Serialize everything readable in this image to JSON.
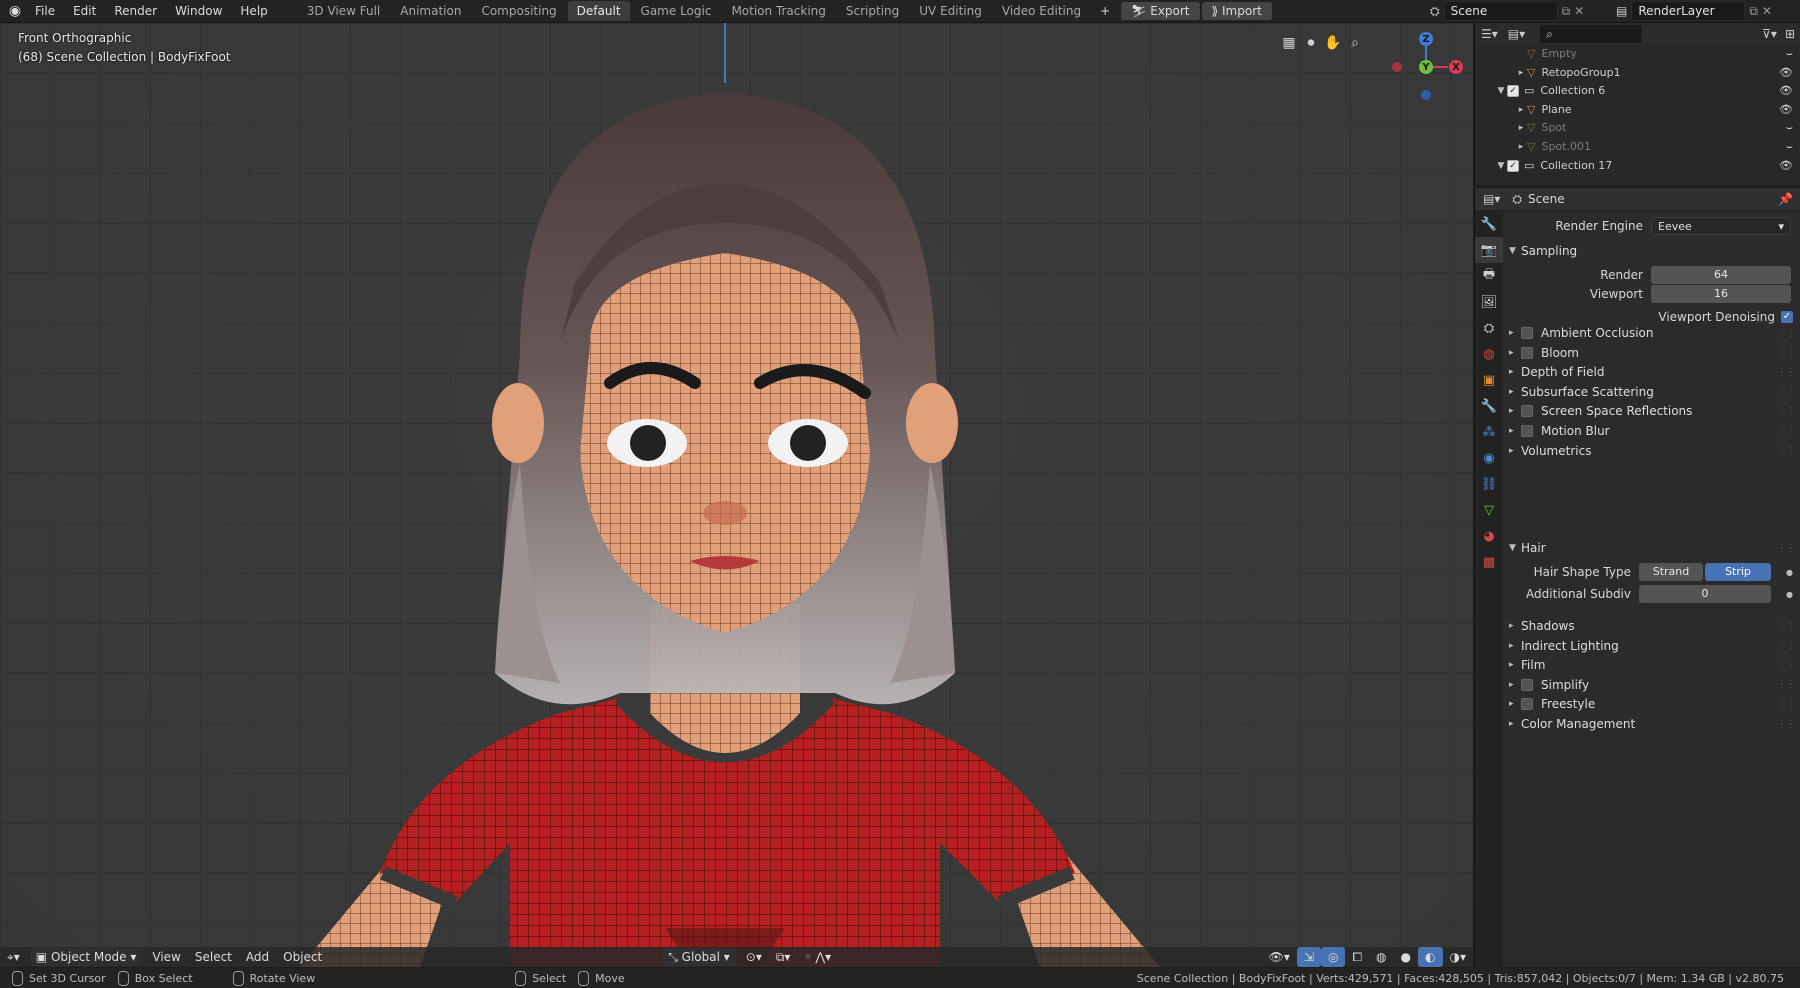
{
  "topbar": {
    "menus": [
      "File",
      "Edit",
      "Render",
      "Window",
      "Help"
    ],
    "workspaces": [
      "3D View Full",
      "Animation",
      "Compositing",
      "Default",
      "Game Logic",
      "Motion Tracking",
      "Scripting",
      "UV Editing",
      "Video Editing"
    ],
    "active_workspace": "Default",
    "export_label": "Export",
    "import_label": "Import",
    "scene_name": "Scene",
    "view_layer": "RenderLayer"
  },
  "viewport": {
    "view_name": "Front Orthographic",
    "collection_info": "(68) Scene Collection | BodyFixFoot",
    "gizmo": {
      "z": "Z",
      "y": "Y",
      "x": "X"
    }
  },
  "viewport_header": {
    "mode": "Object Mode",
    "menus": [
      "View",
      "Select",
      "Add",
      "Object"
    ],
    "orientation": "Global"
  },
  "outliner": {
    "search_placeholder": "",
    "rows": [
      {
        "name": "Empty",
        "dim": true,
        "indent": 2,
        "checkbox": false,
        "expand": false
      },
      {
        "name": "RetopoGroup1",
        "dim": false,
        "indent": 2,
        "checkbox": false,
        "expand": true
      },
      {
        "name": "Collection 6",
        "dim": false,
        "indent": 1,
        "checkbox": true,
        "expand": true
      },
      {
        "name": "Plane",
        "dim": false,
        "indent": 2,
        "checkbox": false,
        "expand": true
      },
      {
        "name": "Spot",
        "dim": true,
        "indent": 2,
        "checkbox": false,
        "expand": true
      },
      {
        "name": "Spot.001",
        "dim": true,
        "indent": 2,
        "checkbox": false,
        "expand": true
      },
      {
        "name": "Collection 17",
        "dim": false,
        "indent": 1,
        "checkbox": true,
        "expand": true
      }
    ]
  },
  "properties": {
    "context": "Scene",
    "render_engine_label": "Render Engine",
    "render_engine": "Eevee",
    "sampling": {
      "title": "Sampling",
      "render_label": "Render",
      "render_value": "64",
      "viewport_label": "Viewport",
      "viewport_value": "16",
      "denoise_label": "Viewport Denoising"
    },
    "panels_a": [
      {
        "label": "Ambient Occlusion",
        "checkbox": true
      },
      {
        "label": "Bloom",
        "checkbox": true
      },
      {
        "label": "Depth of Field",
        "checkbox": false
      },
      {
        "label": "Subsurface Scattering",
        "checkbox": false
      },
      {
        "label": "Screen Space Reflections",
        "checkbox": true
      },
      {
        "label": "Motion Blur",
        "checkbox": true
      },
      {
        "label": "Volumetrics",
        "checkbox": false
      }
    ],
    "hair": {
      "title": "Hair",
      "shape_label": "Hair Shape Type",
      "strand": "Strand",
      "strip": "Strip",
      "subdiv_label": "Additional Subdiv",
      "subdiv_value": "0"
    },
    "panels_b": [
      {
        "label": "Shadows",
        "checkbox": false
      },
      {
        "label": "Indirect Lighting",
        "checkbox": false
      },
      {
        "label": "Film",
        "checkbox": false
      },
      {
        "label": "Simplify",
        "checkbox": true
      },
      {
        "label": "Freestyle",
        "checkbox": true
      },
      {
        "label": "Color Management",
        "checkbox": false
      }
    ]
  },
  "statusbar": {
    "set_cursor": "Set 3D Cursor",
    "box_select": "Box Select",
    "rotate_view": "Rotate View",
    "select": "Select",
    "move": "Move",
    "info": "Scene Collection | BodyFixFoot | Verts:429,571 | Faces:428,505 | Tris:857,042 | Objects:0/7 | Mem: 1.34 GB | v2.80.75"
  },
  "colors": {
    "accent_blue": "#4772b3",
    "shirt_red": "#b62020",
    "skin": "#e2a07a"
  }
}
